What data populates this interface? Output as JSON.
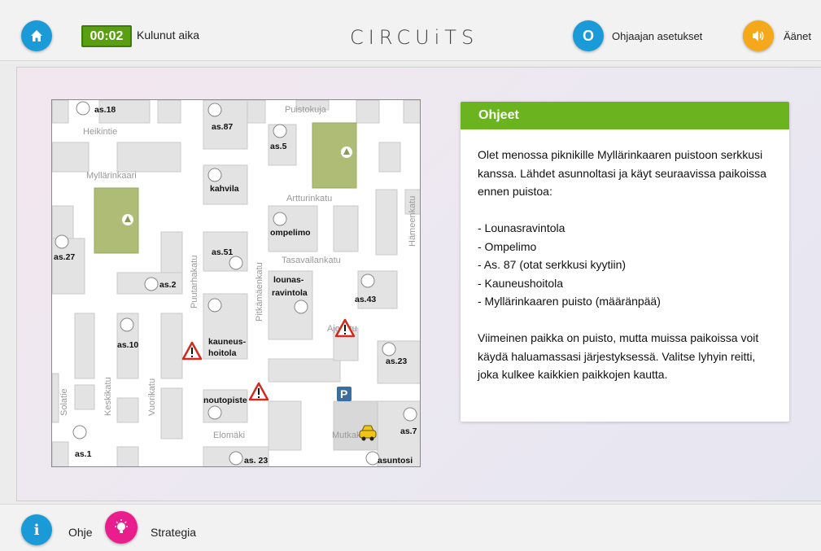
{
  "header": {
    "timer": "00:02",
    "timer_label": "Kulunut aika",
    "logo": "CIRCUiTS",
    "teacher_icon_text": "O",
    "teacher_label": "Ohjaajan asetukset",
    "sound_label": "Äänet"
  },
  "footer": {
    "help_icon_text": "i",
    "help_label": "Ohje",
    "strategy_label": "Strategia"
  },
  "instructions": {
    "title": "Ohjeet",
    "intro": "Olet menossa piknikille Myllärinkaaren puistoon serkkusi kanssa. Lähdet asunnoltasi ja käyt seuraavissa paikoissa ennen puistoa:",
    "stops": [
      "- Lounasravintola",
      "- Ompelimo",
      "- As. 87 (otat serkkusi kyytiin)",
      "- Kauneushoitola",
      "- Myllärinkaaren puisto (määränpää)"
    ],
    "outro": "Viimeinen paikka on puisto, mutta muissa paikoissa voit käydä haluamassasi järjestyksessä. Valitse lyhyin reitti, joka kulkee kaikkien paikkojen kautta."
  },
  "map": {
    "streets": [
      "Heikintie",
      "Puistokuja",
      "Myllärinkaari",
      "Artturinkatu",
      "Hämeenkatu",
      "Tasavallankatu",
      "Puutarhakatu",
      "Pitkämäenkatu",
      "Ajokatu",
      "Solatie",
      "Keskikatu",
      "Vuorikatu",
      "Elomäki",
      "Mutkakatu"
    ],
    "places": [
      "as.18",
      "as.87",
      "as.5",
      "kahvila",
      "ompelimo",
      "as.27",
      "as.51",
      "lounas-",
      "ravintola",
      "as.2",
      "as.43",
      "as.10",
      "kauneus-",
      "hoitola",
      "as.23",
      "noutopiste",
      "as.7",
      "as.1",
      "as. 23",
      "asuntosi"
    ],
    "parking": "P"
  }
}
